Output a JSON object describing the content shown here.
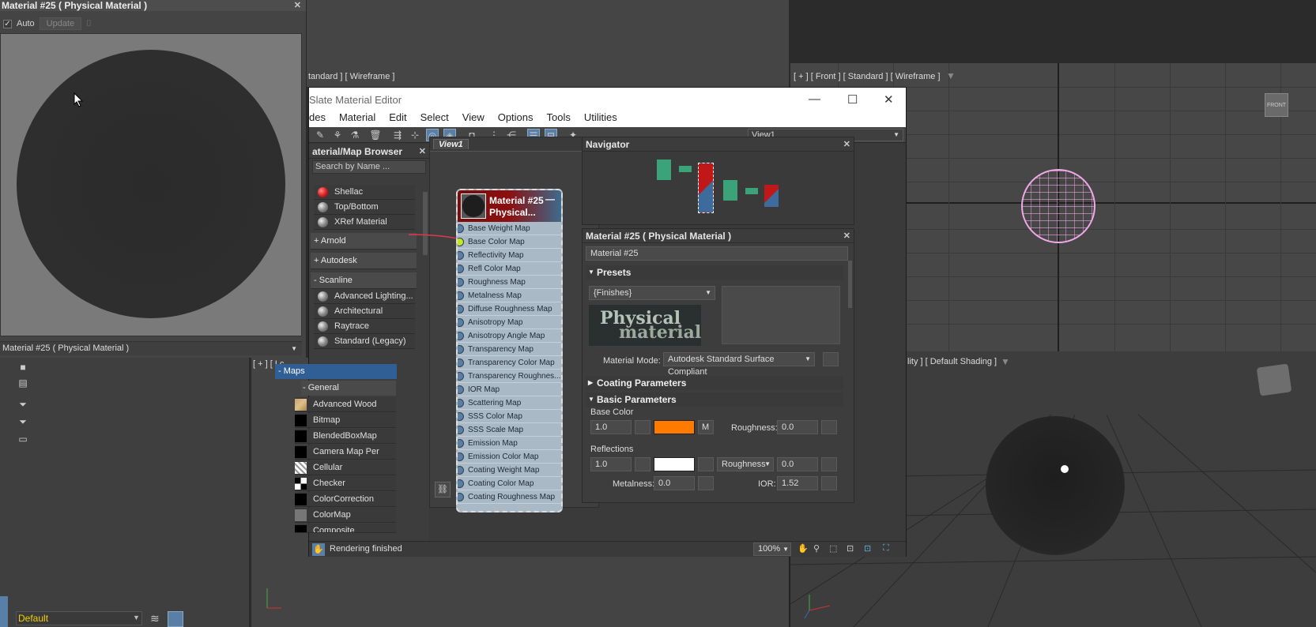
{
  "viewports": {
    "top_left_label": "tandard ] [ Wireframe ]",
    "front_label": "[ + ] [ Front ] [ Standard ] [ Wireframe ]",
    "perspective_label": "lity ] [ Default Shading ]",
    "left_bottom_label": "[ + ] [ Lc"
  },
  "render_window": {
    "title": "Material #25  ( Physical Material )",
    "auto_label": "Auto",
    "update_label": "Update",
    "footer": "Material #25  ( Physical Material )"
  },
  "slate": {
    "title": "Slate Material Editor",
    "menu": [
      "des",
      "Material",
      "Edit",
      "Select",
      "View",
      "Options",
      "Tools",
      "Utilities"
    ],
    "view_select": "View1",
    "view_tab": "View1",
    "status": "Rendering finished",
    "zoom": "100%"
  },
  "browser": {
    "title": "aterial/Map Browser",
    "search_placeholder": "Search by Name ...",
    "items_top": [
      "Shellac",
      "Top/Bottom",
      "XRef Material"
    ],
    "groups": [
      "Arnold",
      "Autodesk",
      "Scanline"
    ],
    "scanline_items": [
      "Advanced Lighting...",
      "Architectural",
      "Raytrace",
      "Standard (Legacy)"
    ],
    "maps_label": "Maps",
    "general_label": "General",
    "maps": [
      "Advanced Wood",
      "Bitmap",
      "BlendedBoxMap",
      "Camera Map Per Pixel",
      "Cellular",
      "Checker",
      "ColorCorrection",
      "ColorMap",
      "Composite"
    ]
  },
  "node": {
    "title_line1": "Material #25",
    "title_line2": "Physical...",
    "slots": [
      "Base Weight Map",
      "Base Color Map",
      "Reflectivity Map",
      "Refl Color Map",
      "Roughness Map",
      "Metalness Map",
      "Diffuse Roughness Map",
      "Anisotropy Map",
      "Anisotropy Angle Map",
      "Transparency Map",
      "Transparency Color Map",
      "Transparency Roughnes...",
      "IOR Map",
      "Scattering Map",
      "SSS Color Map",
      "SSS Scale Map",
      "Emission Map",
      "Emission Color Map",
      "Coating Weight Map",
      "Coating Color Map",
      "Coating Roughness Map"
    ]
  },
  "navigator": {
    "title": "Navigator"
  },
  "params": {
    "title": "Material #25  ( Physical Material )",
    "name_value": "Material #25",
    "presets_label": "Presets",
    "finishes": "{Finishes}",
    "logo_text_1": "Physical",
    "logo_text_2": "material",
    "mode_label": "Material Mode:",
    "mode_value": "Autodesk Standard Surface Compliant",
    "coating_label": "Coating Parameters",
    "basic_label": "Basic Parameters",
    "base_color_label": "Base Color",
    "base_weight": "1.0",
    "m_label": "M",
    "roughness_label": "Roughness:",
    "roughness_value": "0.0",
    "reflections_label": "Reflections",
    "refl_weight": "1.0",
    "refl_mode": "Roughness",
    "refl_rough": "0.0",
    "metalness_label": "Metalness:",
    "metalness_value": "0.0",
    "ior_label": "IOR:",
    "ior_value": "1.52",
    "base_color_hex": "#ff7b00",
    "refl_color_hex": "#ffffff"
  },
  "bottom": {
    "layer": "Default"
  }
}
